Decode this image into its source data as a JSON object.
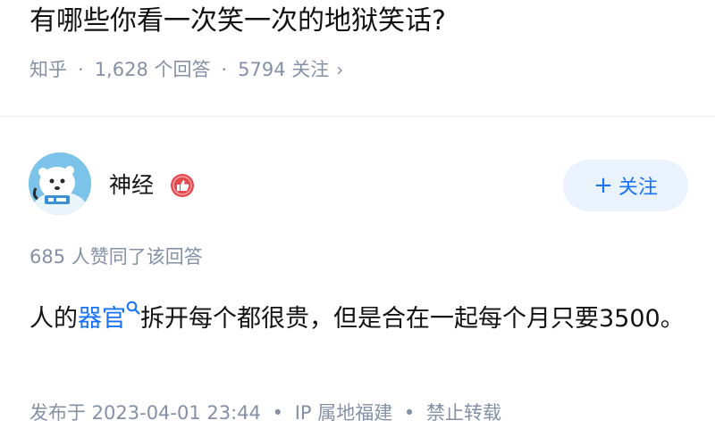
{
  "question": {
    "title": "有哪些你看一次笑一次的地狱笑话?",
    "source": "知乎",
    "answers_count": "1,628 个回答",
    "follow_count": "5794 关注",
    "separator": "·",
    "chevron": "›"
  },
  "author": {
    "name": "神经",
    "follow_label": "关注",
    "follow_plus": "+"
  },
  "answer": {
    "likes": "685 人赞同了该回答",
    "text_before": "人的",
    "keyword": "器官",
    "text_after": "拆开每个都很贵，但是合在一起每个月只要3500。",
    "published": "发布于 2023-04-01 23:44",
    "ip": "IP 属地福建",
    "rights": "禁止转载",
    "separator": "•"
  },
  "colors": {
    "accent": "#1772f6",
    "muted": "#8590a6",
    "text": "#121212",
    "follow_bg": "#eaf3fd",
    "badge_red": "#e5484d"
  }
}
